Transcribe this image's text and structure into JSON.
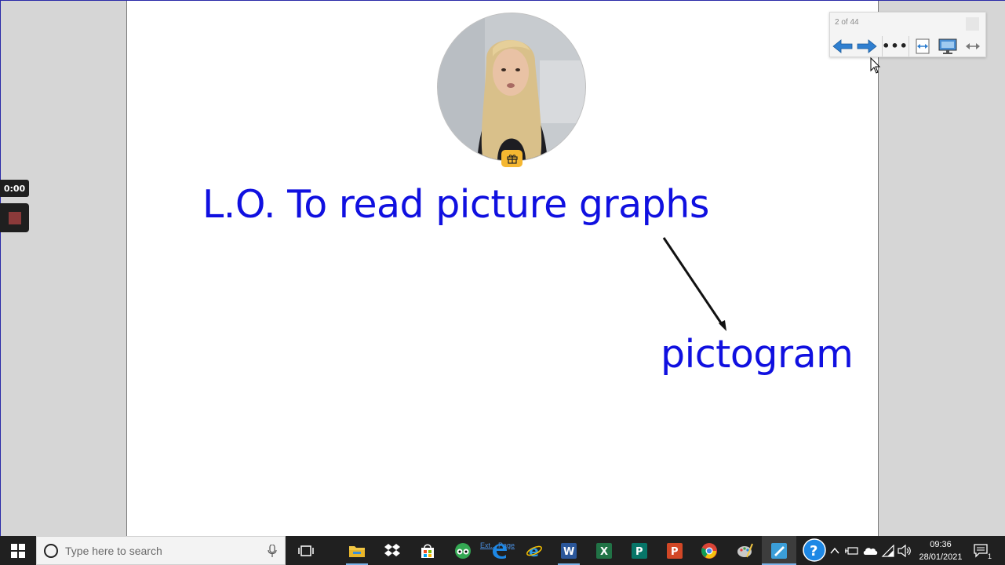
{
  "slide": {
    "title": "L.O. To read picture graphs",
    "annotation": "pictogram",
    "text_color": "#1010e0"
  },
  "recorder": {
    "timer": "0:00"
  },
  "navigator": {
    "page_counter": "2 of 44",
    "buttons": [
      "previous-page",
      "next-page",
      "more-options",
      "fit-width",
      "presentation-mode",
      "collapse"
    ]
  },
  "taskbar": {
    "search_placeholder": "Type here to search",
    "overlay_link": "Ext... Page",
    "time": "09:36",
    "date": "28/01/2021",
    "notification_count": "1",
    "apps": [
      "task-view",
      "file-explorer",
      "dropbox",
      "microsoft-store",
      "tripadvisor",
      "edge",
      "internet-explorer",
      "word",
      "excel",
      "publisher",
      "powerpoint",
      "chrome",
      "paint",
      "whiteboard-app",
      "help"
    ]
  }
}
